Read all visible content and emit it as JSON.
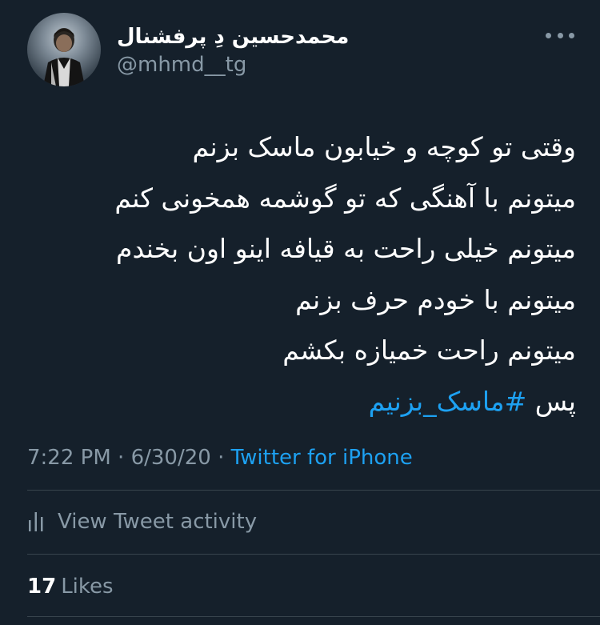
{
  "author": {
    "display_name": "محمدحسین دِ پرفشنال",
    "handle": "@mhmd__tg"
  },
  "tweet": {
    "lines": [
      "وقتی تو کوچه و خیابون ماسک بزنم",
      "میتونم با آهنگی که تو گوشمه همخونی کنم",
      "میتونم خیلی راحت به قیافه اینو اون بخندم",
      "میتونم با خودم حرف بزنم",
      "میتونم راحت خمیازه بکشم"
    ],
    "last_line_prefix": "پس",
    "hashtag": "#ماسک_بزنیم"
  },
  "meta": {
    "time": "7:22 PM",
    "separator": "·",
    "date": "6/30/20",
    "source": "Twitter for iPhone"
  },
  "activity": {
    "label": "View Tweet activity",
    "icon": "bar-chart-icon"
  },
  "likes": {
    "count": "17",
    "label": "Likes"
  },
  "colors": {
    "background": "#15202b",
    "secondary_text": "#8899a6",
    "accent": "#1da1f2",
    "divider": "#38444d"
  }
}
